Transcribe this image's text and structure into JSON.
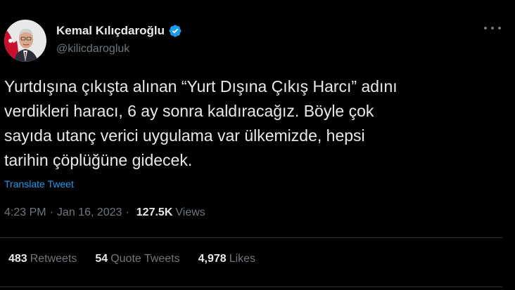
{
  "author": {
    "name": "Kemal Kılıçdaroğlu",
    "handle": "@kilicdarogluk",
    "verified": true
  },
  "tweet": {
    "text": "Yurtdışına çıkışta alınan “Yurt Dışına Çıkış Harcı” adını\nverdikleri haracı, 6 ay sonra kaldıracağız. Böyle çok\nsayıda utanç verici uygulama var ülkemizde, hepsi\ntarihin çöplüğüne gidecek.",
    "translate_label": "Translate Tweet"
  },
  "meta": {
    "time": "4:23 PM",
    "separator": "·",
    "date": "Jan 16, 2023",
    "views_count": "127.5K",
    "views_label": "Views"
  },
  "stats": {
    "retweets": {
      "count": "483",
      "label": "Retweets"
    },
    "quotes": {
      "count": "54",
      "label": "Quote Tweets"
    },
    "likes": {
      "count": "4,978",
      "label": "Likes"
    }
  },
  "colors": {
    "background": "#000000",
    "text": "#e7e9ea",
    "secondary": "#71767b",
    "link": "#1d9bf0",
    "divider": "#2f3336",
    "verified_badge": "#1d9bf0"
  },
  "icons": {
    "verified": "verified-badge-icon",
    "more": "more-horizontal-icon"
  }
}
